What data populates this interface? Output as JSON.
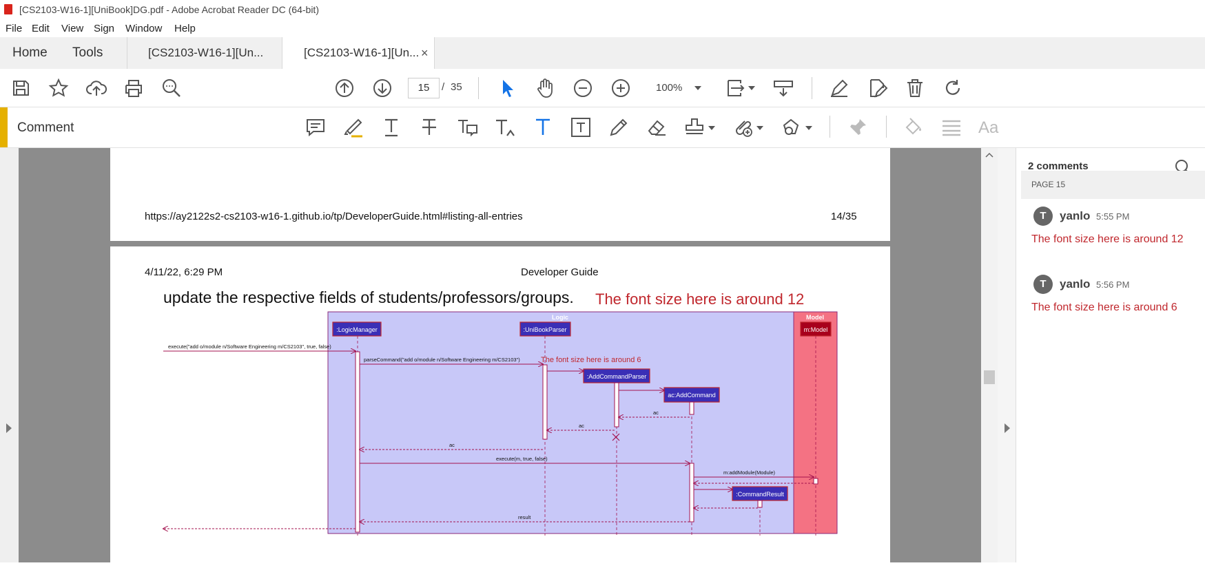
{
  "window": {
    "title": "[CS2103-W16-1][UniBook]DG.pdf - Adobe Acrobat Reader DC (64-bit)"
  },
  "menu": [
    "File",
    "Edit",
    "View",
    "Sign",
    "Window",
    "Help"
  ],
  "tabs": {
    "home": "Home",
    "tools": "Tools",
    "doc1": "[CS2103-W16-1][Un...",
    "doc2": "[CS2103-W16-1][Un...",
    "close": "×"
  },
  "toolbar": {
    "page_current": "15",
    "page_sep": "/",
    "page_total": "35",
    "zoom": "100%"
  },
  "comment_toolbar": {
    "label": "Comment",
    "text_size_label": "Aa"
  },
  "page_prev": {
    "url": "https://ay2122s2-cs2103-w16-1.github.io/tp/DeveloperGuide.html#listing-all-entries",
    "page_no": "14/35"
  },
  "page": {
    "date": "4/11/22, 6:29 PM",
    "header": "Developer Guide",
    "body_text": "update the respective fields of students/professors/groups.",
    "annotation_12": "The font size here is around 12",
    "annotation_6": "The font size here is around 6"
  },
  "diagram": {
    "logic_label": "Logic",
    "model_label": "Model",
    "participants": [
      ":LogicManager",
      ":UniBookParser",
      ":AddCommandParser",
      "ac:AddCommand",
      "m:Model",
      ":CommandResult"
    ],
    "messages": [
      "execute(\"add o/module n/Software Engineering m/CS2103\", true, false)",
      "parseCommand(\"add o/module n/Software Engineering m/CS2103\")",
      "ac",
      "ac",
      "ac",
      "execute(m, true, false)",
      "m:addModule(Module)",
      "result"
    ]
  },
  "comments_panel": {
    "header": "2 comments",
    "page_label": "PAGE 15",
    "comments": [
      {
        "avatar": "T",
        "user": "yanlo",
        "time": "5:55 PM",
        "text": "The font size here is around 12"
      },
      {
        "avatar": "T",
        "user": "yanlo",
        "time": "5:56 PM",
        "text": "The font size here is around 6"
      }
    ]
  },
  "colors": {
    "accent_yellow": "#e5b000",
    "annotation_red": "#c0272d",
    "logic_bg": "#c8c8f8",
    "model_bg": "#f47283",
    "participant": "#3a2fb6"
  }
}
